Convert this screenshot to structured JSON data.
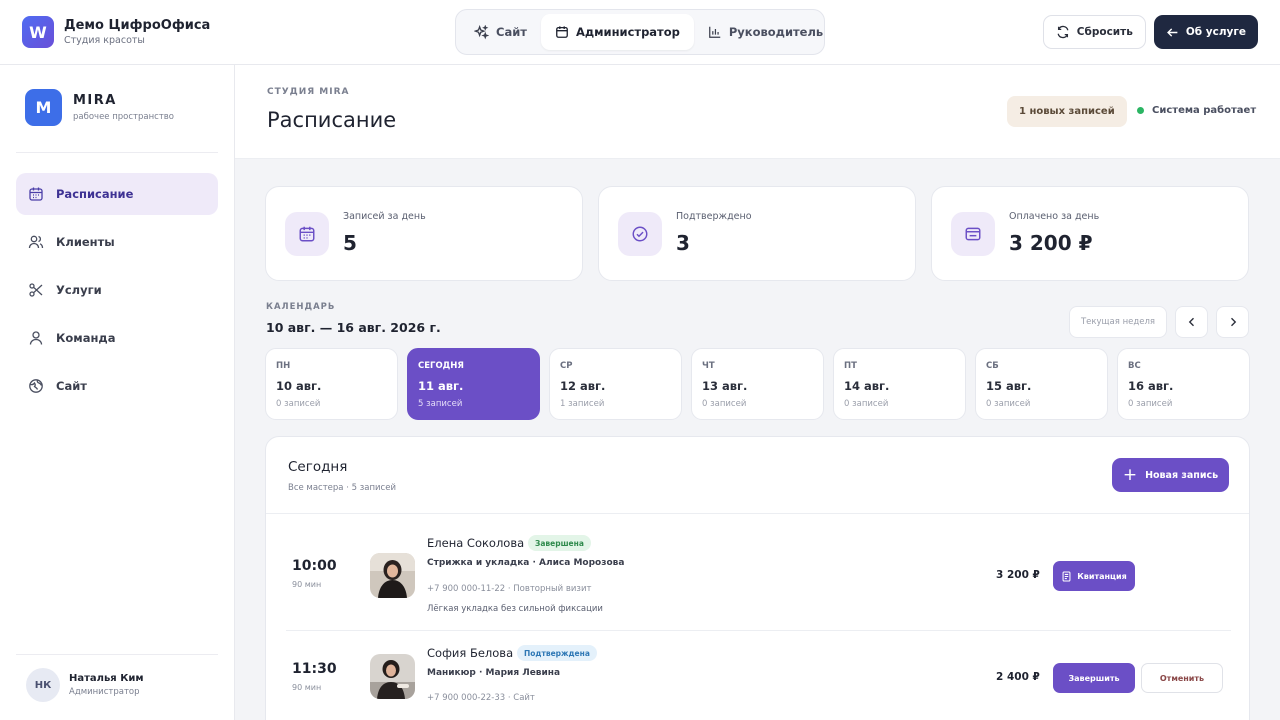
{
  "brand": {
    "name": "Демо ЦифроОфиса",
    "subtitle": "Студия красоты",
    "logo_letter": "W"
  },
  "mode_switch": [
    {
      "label": "Сайт",
      "icon": "sparkles-icon"
    },
    {
      "label": "Администратор",
      "icon": "calendar-icon",
      "active": true
    },
    {
      "label": "Руководитель",
      "icon": "bar-chart-icon"
    }
  ],
  "top_actions": {
    "reset_label": "Сбросить",
    "about_label": "Об услуге"
  },
  "workspace": {
    "logo_letter": "M",
    "name": "MIRA",
    "subtitle": "рабочее пространство"
  },
  "sidebar": {
    "items": [
      {
        "label": "Расписание",
        "icon": "calendar-icon",
        "active": true
      },
      {
        "label": "Клиенты",
        "icon": "users-icon"
      },
      {
        "label": "Услуги",
        "icon": "scissors-icon"
      },
      {
        "label": "Команда",
        "icon": "user-icon"
      },
      {
        "label": "Сайт",
        "icon": "globe-icon"
      }
    ]
  },
  "user": {
    "initials": "НК",
    "name": "Наталья Ким",
    "role": "Администратор"
  },
  "header": {
    "breadcrumb": "СТУДИЯ MIRA",
    "title": "Расписание",
    "new_badge": "1 новых записей",
    "status": "Система работает"
  },
  "stats": [
    {
      "label": "Записей за день",
      "value": "5",
      "icon": "calendar-icon"
    },
    {
      "label": "Подтверждено",
      "value": "3",
      "icon": "check-circle-icon"
    },
    {
      "label": "Оплачено за день",
      "value": "3 200 ₽",
      "icon": "wallet-icon"
    }
  ],
  "calendar": {
    "label": "КАЛЕНДАРЬ",
    "range": "10 авг. — 16 авг. 2026 г.",
    "current_week_label": "Текущая неделя",
    "days": [
      {
        "dow": "ПН",
        "date": "10 авг.",
        "count": "0 записей"
      },
      {
        "dow": "СЕГОДНЯ",
        "date": "11 авг.",
        "count": "5 записей",
        "today": true
      },
      {
        "dow": "СР",
        "date": "12 авг.",
        "count": "1 записей"
      },
      {
        "dow": "ЧТ",
        "date": "13 авг.",
        "count": "0 записей"
      },
      {
        "dow": "ПТ",
        "date": "14 авг.",
        "count": "0 записей"
      },
      {
        "dow": "СБ",
        "date": "15 авг.",
        "count": "0 записей"
      },
      {
        "dow": "ВС",
        "date": "16 авг.",
        "count": "0 записей"
      }
    ]
  },
  "panel": {
    "title": "Сегодня",
    "subtitle": "Все мастера · 5 записей",
    "new_button": "Новая запись",
    "appointments": [
      {
        "time": "10:00",
        "duration": "90 мин",
        "client": "Елена Соколова",
        "status": "Завершена",
        "service": "Стрижка и укладка · Алиса Морозова",
        "phone": "+7 900 000-11-22 · Повторный визит",
        "note": "Лёгкая укладка без сильной фиксации",
        "price": "3 200 ₽",
        "action": "Квитанция"
      },
      {
        "time": "11:30",
        "duration": "90 мин",
        "client": "София Белова",
        "status": "Подтверждена",
        "service": "Маникюр · Мария Левина",
        "phone": "+7 900 000-22-33 · Сайт",
        "price": "2 400 ₽",
        "action_primary": "Завершить",
        "action_secondary": "Отменить"
      }
    ]
  },
  "colors": {
    "accent": "#6b4fc6",
    "dark": "#1f2840",
    "success": "#2bb563"
  }
}
